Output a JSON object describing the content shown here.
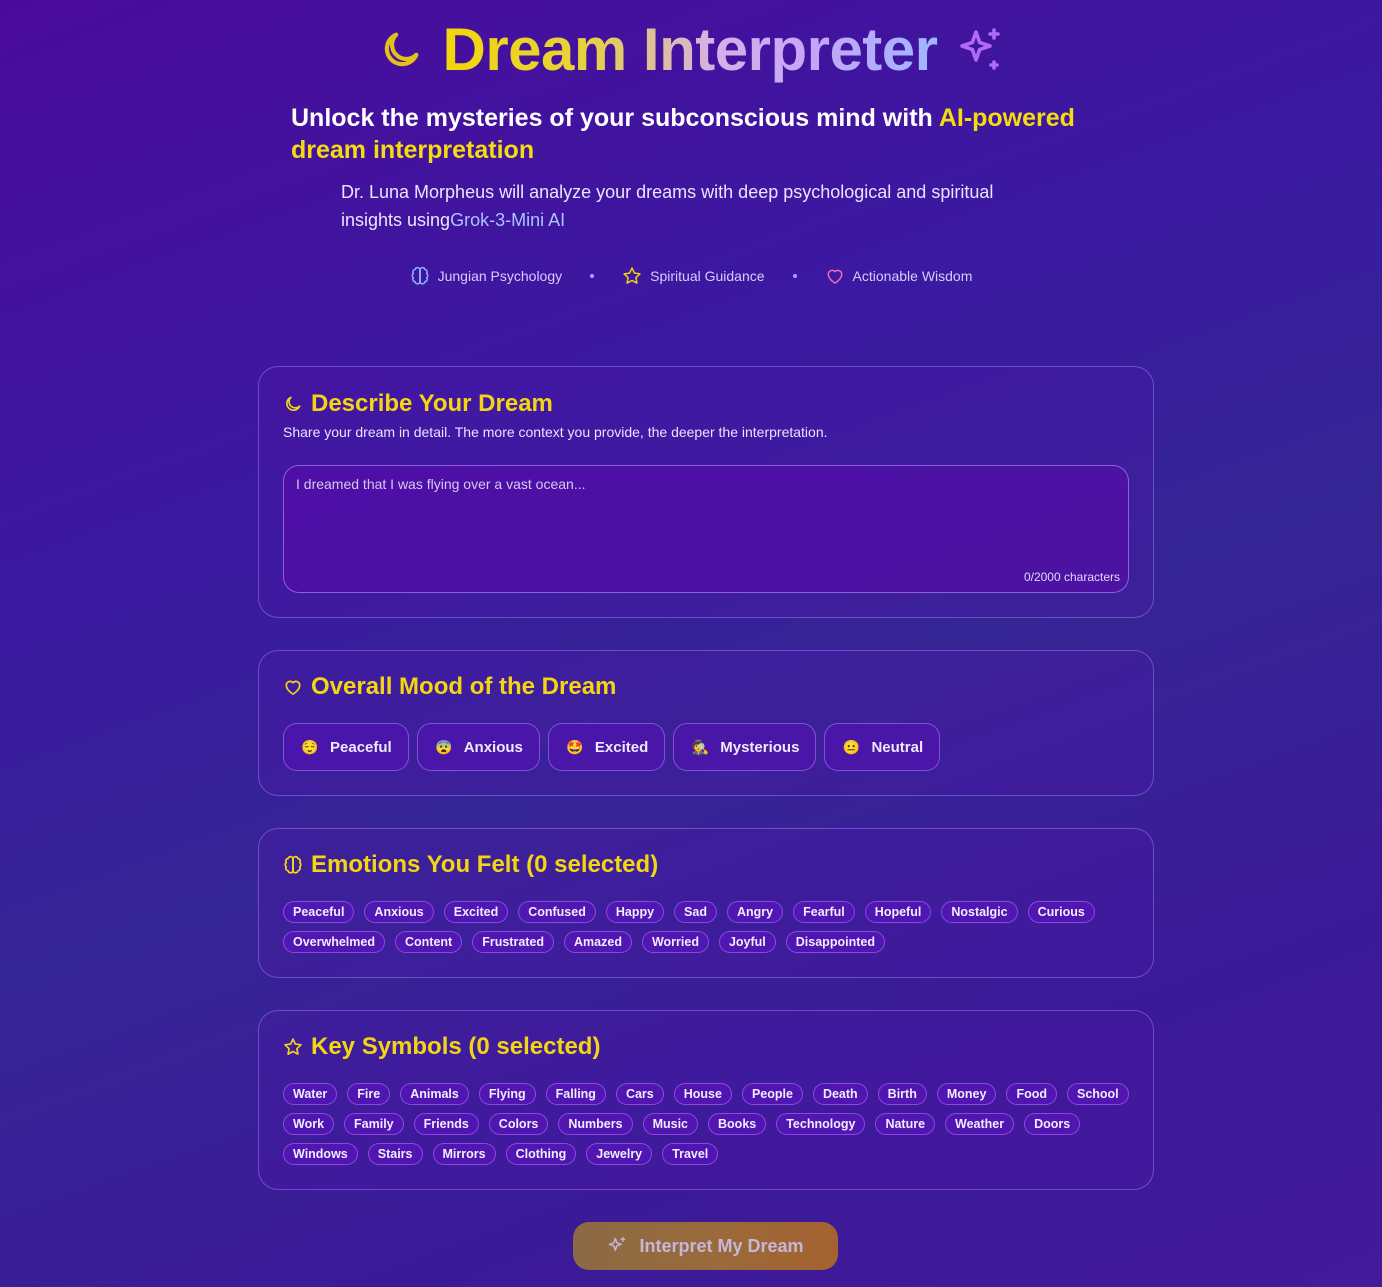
{
  "header": {
    "title": "Dream Interpreter",
    "tagline_prefix": "Unlock the mysteries of your subconscious mind with ",
    "tagline_highlight": "AI-powered dream interpretation",
    "subline_prefix": "Dr. Luna Morpheus will analyze your dreams with deep psychological and spiritual insights using",
    "subline_ai": "Grok-3-Mini AI",
    "features": [
      {
        "icon": "brain-icon",
        "label": "Jungian Psychology"
      },
      {
        "icon": "star-icon",
        "label": "Spiritual Guidance"
      },
      {
        "icon": "heart-icon",
        "label": "Actionable Wisdom"
      }
    ]
  },
  "describe": {
    "title": "Describe Your Dream",
    "description": "Share your dream in detail. The more context you provide, the deeper the interpretation.",
    "placeholder": "I dreamed that I was flying over a vast ocean...",
    "char_count": "0/2000 characters"
  },
  "mood": {
    "title": "Overall Mood of the Dream",
    "options": [
      {
        "emoji": "😌",
        "label": "Peaceful"
      },
      {
        "emoji": "😨",
        "label": "Anxious"
      },
      {
        "emoji": "🤩",
        "label": "Excited"
      },
      {
        "emoji": "🕵",
        "label": "Mysterious"
      },
      {
        "emoji": "😐",
        "label": "Neutral"
      }
    ]
  },
  "emotions": {
    "title": "Emotions You Felt (0 selected)",
    "items": [
      "Peaceful",
      "Anxious",
      "Excited",
      "Confused",
      "Happy",
      "Sad",
      "Angry",
      "Fearful",
      "Hopeful",
      "Nostalgic",
      "Curious",
      "Overwhelmed",
      "Content",
      "Frustrated",
      "Amazed",
      "Worried",
      "Joyful",
      "Disappointed"
    ]
  },
  "symbols": {
    "title": "Key Symbols (0 selected)",
    "items": [
      "Water",
      "Fire",
      "Animals",
      "Flying",
      "Falling",
      "Cars",
      "House",
      "People",
      "Death",
      "Birth",
      "Money",
      "Food",
      "School",
      "Work",
      "Family",
      "Friends",
      "Colors",
      "Numbers",
      "Music",
      "Books",
      "Technology",
      "Nature",
      "Weather",
      "Doors",
      "Windows",
      "Stairs",
      "Mirrors",
      "Clothing",
      "Jewelry",
      "Travel"
    ]
  },
  "action": {
    "label": "Interpret My Dream"
  },
  "colors": {
    "accent_yellow": "#f4d512",
    "accent_purple": "#a855f7",
    "button_gradient_start": "#8b6a45",
    "button_gradient_end": "#a5622f"
  }
}
